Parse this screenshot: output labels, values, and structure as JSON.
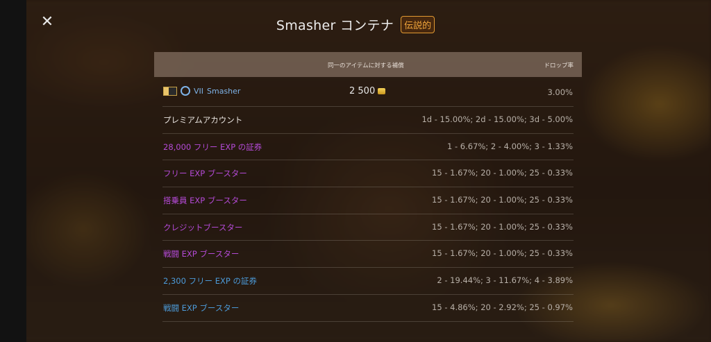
{
  "window": {
    "title": "Smasher コンテナ",
    "rarity_badge": "伝説的",
    "close_icon": "close-icon"
  },
  "table": {
    "header": {
      "reward": "同一のアイテムに対する補償",
      "drop_rate": "ドロップ率"
    },
    "vehicle_row": {
      "tier": "VII",
      "name": "Smasher",
      "compensation": "2 500",
      "rate": "3.00%"
    },
    "rows": [
      {
        "label": "プレミアムアカウント",
        "rate": "1d - 15.00%; 2d - 15.00%; 3d - 5.00%",
        "color": "#e9e4df"
      },
      {
        "label": "28,000 フリー EXP の証券",
        "rate": "1 - 6.67%; 2 - 4.00%; 3 - 1.33%",
        "color": "#b44ad6"
      },
      {
        "label": "フリー EXP ブースター",
        "rate": "15 - 1.67%; 20 - 1.00%; 25 - 0.33%",
        "color": "#b44ad6"
      },
      {
        "label": "搭乗員 EXP ブースター",
        "rate": "15 - 1.67%; 20 - 1.00%; 25 - 0.33%",
        "color": "#b44ad6"
      },
      {
        "label": "クレジットブースター",
        "rate": "15 - 1.67%; 20 - 1.00%; 25 - 0.33%",
        "color": "#b44ad6"
      },
      {
        "label": "戦闘 EXP ブースター",
        "rate": "15 - 1.67%; 20 - 1.00%; 25 - 0.33%",
        "color": "#b44ad6"
      },
      {
        "label": "2,300 フリー EXP の証券",
        "rate": "2 - 19.44%; 3 - 11.67%; 4 - 3.89%",
        "color": "#4c9ad8"
      },
      {
        "label": "戦闘 EXP ブースター",
        "rate": "15 - 4.86%; 20 - 2.92%; 25 - 0.97%",
        "color": "#4c9ad8"
      }
    ]
  },
  "colors": {
    "rarity": "#f0a53a",
    "tank": "#7eb3e8"
  }
}
